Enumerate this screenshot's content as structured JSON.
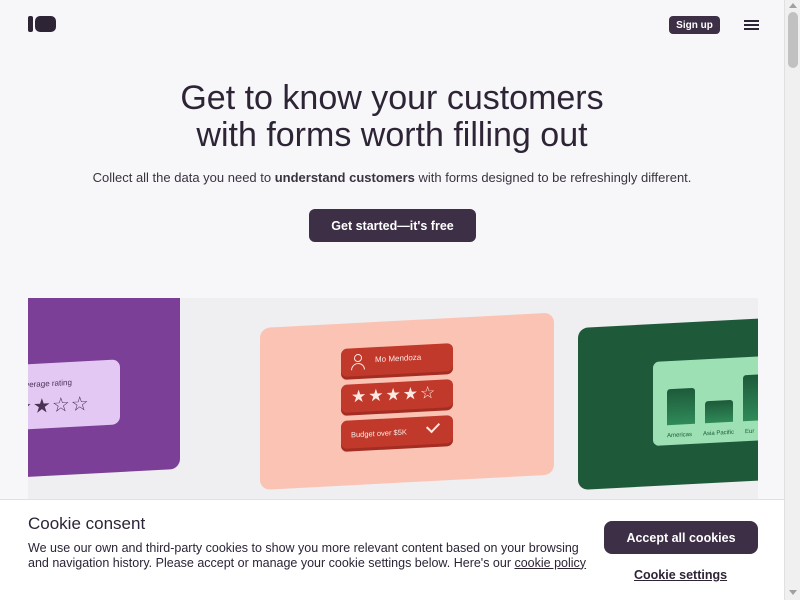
{
  "header": {
    "signup_label": "Sign up"
  },
  "hero": {
    "headline_line1": "Get to know your customers",
    "headline_line2": "with forms worth filling out",
    "sub_before": "Collect all the data you need to ",
    "sub_bold": "understand customers",
    "sub_after": " with forms designed to be refreshingly different.",
    "cta_label": "Get started—it's free"
  },
  "showcase": {
    "rating_label": "Average rating",
    "rating_stars": "★★☆☆",
    "form_name": "Mo Mendoza",
    "form_stars": "★★★★☆",
    "form_budget": "Budget over $5K",
    "chart_labels": [
      "Americas",
      "Asia Pacific",
      "Eur"
    ]
  },
  "cookie": {
    "title": "Cookie consent",
    "text": "We use our own and third-party cookies to show you more relevant content based on your browsing and navigation history. Please accept or manage your cookie settings below. Here's our ",
    "policy_link": "cookie policy",
    "accept_label": "Accept all cookies",
    "settings_label": "Cookie settings"
  },
  "colors": {
    "primary": "#3d2f45",
    "purple_card": "#7b3f97",
    "salmon_card": "#fbc3b4",
    "green_card": "#1e5a3a"
  }
}
